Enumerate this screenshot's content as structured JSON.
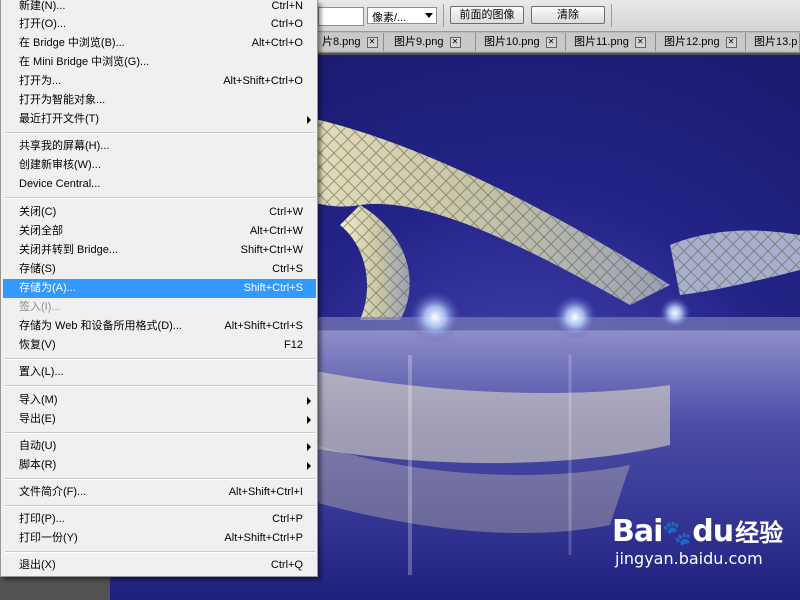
{
  "options_bar": {
    "unit_select": "像素/...",
    "front_image_button": "前面的图像",
    "clear_button": "清除"
  },
  "tabs": [
    {
      "label": "片8.png"
    },
    {
      "label": "图片9.png"
    },
    {
      "label": "图片10.png"
    },
    {
      "label": "图片11.png"
    },
    {
      "label": "图片12.png"
    },
    {
      "label": "图片13.p"
    }
  ],
  "menu": {
    "items": [
      {
        "label": "新建(N)...",
        "shortcut": "Ctrl+N"
      },
      {
        "label": "打开(O)...",
        "shortcut": "Ctrl+O"
      },
      {
        "label": "在 Bridge 中浏览(B)...",
        "shortcut": "Alt+Ctrl+O"
      },
      {
        "label": "在 Mini Bridge 中浏览(G)...",
        "shortcut": ""
      },
      {
        "label": "打开为...",
        "shortcut": "Alt+Shift+Ctrl+O"
      },
      {
        "label": "打开为智能对象...",
        "shortcut": ""
      },
      {
        "label": "最近打开文件(T)",
        "shortcut": ""
      },
      {
        "label": "共享我的屏幕(H)...",
        "shortcut": ""
      },
      {
        "label": "创建新审核(W)...",
        "shortcut": ""
      },
      {
        "label": "Device Central...",
        "shortcut": ""
      },
      {
        "label": "关闭(C)",
        "shortcut": "Ctrl+W"
      },
      {
        "label": "关闭全部",
        "shortcut": "Alt+Ctrl+W"
      },
      {
        "label": "关闭并转到 Bridge...",
        "shortcut": "Shift+Ctrl+W"
      },
      {
        "label": "存储(S)",
        "shortcut": "Ctrl+S"
      },
      {
        "label": "存储为(A)...",
        "shortcut": "Shift+Ctrl+S"
      },
      {
        "label": "签入(I)...",
        "shortcut": ""
      },
      {
        "label": "存储为 Web 和设备所用格式(D)...",
        "shortcut": "Alt+Shift+Ctrl+S"
      },
      {
        "label": "恢复(V)",
        "shortcut": "F12"
      },
      {
        "label": "置入(L)...",
        "shortcut": ""
      },
      {
        "label": "导入(M)",
        "shortcut": ""
      },
      {
        "label": "导出(E)",
        "shortcut": ""
      },
      {
        "label": "自动(U)",
        "shortcut": ""
      },
      {
        "label": "脚本(R)",
        "shortcut": ""
      },
      {
        "label": "文件简介(F)...",
        "shortcut": "Alt+Shift+Ctrl+I"
      },
      {
        "label": "打印(P)...",
        "shortcut": "Ctrl+P"
      },
      {
        "label": "打印一份(Y)",
        "shortcut": "Alt+Shift+Ctrl+P"
      },
      {
        "label": "退出(X)",
        "shortcut": "Ctrl+Q"
      }
    ]
  },
  "watermark": {
    "brand": "Bai",
    "brand_suffix": "du",
    "jingyan": "经验",
    "url": "jingyan.baidu.com"
  },
  "colors": {
    "highlight": "#3399ff",
    "menu_bg": "#f0f0f0",
    "canvas_sky": "#1c1c78"
  }
}
